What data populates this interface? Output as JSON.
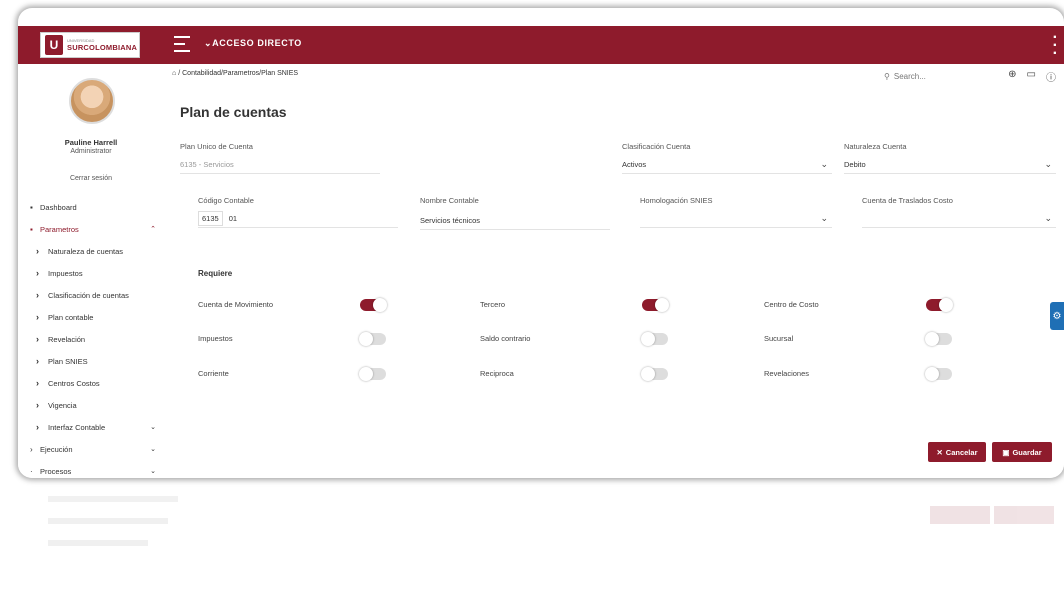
{
  "header": {
    "logo_small": "UNIVERSIDAD",
    "logo_name": "SURCOLOMBIANA",
    "acceso_label": "⌄ACCESO DIRECTO"
  },
  "user": {
    "name": "Pauline Harrell",
    "role": "Administrator",
    "logout": "Cerrar sesión"
  },
  "nav": {
    "dashboard": "Dashboard",
    "parametros": "Parametros",
    "sub": [
      "Naturaleza de cuentas",
      "Impuestos",
      "Clasificación de cuentas",
      "Plan contable",
      "Revelación",
      "Plan SNIES",
      "Centros Costos",
      "Vigencia",
      "Interfaz Contable"
    ],
    "ejecucion": "Ejecución",
    "procesos": "Procesos"
  },
  "breadcrumb": "/ Contabilidad/Parametros/Plan SNIES",
  "search_placeholder": "Search...",
  "page_title": "Plan de cuentas",
  "form": {
    "puc_label": "Plan Unico de Cuenta",
    "puc_value": "6135 - Servicios",
    "clasif_label": "Clasificación Cuenta",
    "clasif_value": "Activos",
    "naturaleza_label": "Naturaleza Cuenta",
    "naturaleza_value": "Debito",
    "codigo_label": "Código Contable",
    "codigo_prefix": "6135",
    "codigo_value": "01",
    "nombre_label": "Nombre Contable",
    "nombre_value": "Servicios técnicos",
    "homolog_label": "Homologación SNIES",
    "homolog_value": "",
    "traslados_label": "Cuenta de Traslados Costo",
    "traslados_value": ""
  },
  "requiere": {
    "title": "Requiere",
    "toggles": [
      {
        "label": "Cuenta de Movimiento",
        "on": true
      },
      {
        "label": "Tercero",
        "on": true
      },
      {
        "label": "Centro de Costo",
        "on": true
      },
      {
        "label": "Impuestos",
        "on": false
      },
      {
        "label": "Saldo contrario",
        "on": false
      },
      {
        "label": "Sucursal",
        "on": false
      },
      {
        "label": "Corriente",
        "on": false
      },
      {
        "label": "Reciproca",
        "on": false
      },
      {
        "label": "Revelaciones",
        "on": false
      }
    ]
  },
  "buttons": {
    "cancel": "Cancelar",
    "save": "Guardar"
  },
  "colors": {
    "brand": "#8e1b2c",
    "side_tab": "#1f6fb5"
  }
}
